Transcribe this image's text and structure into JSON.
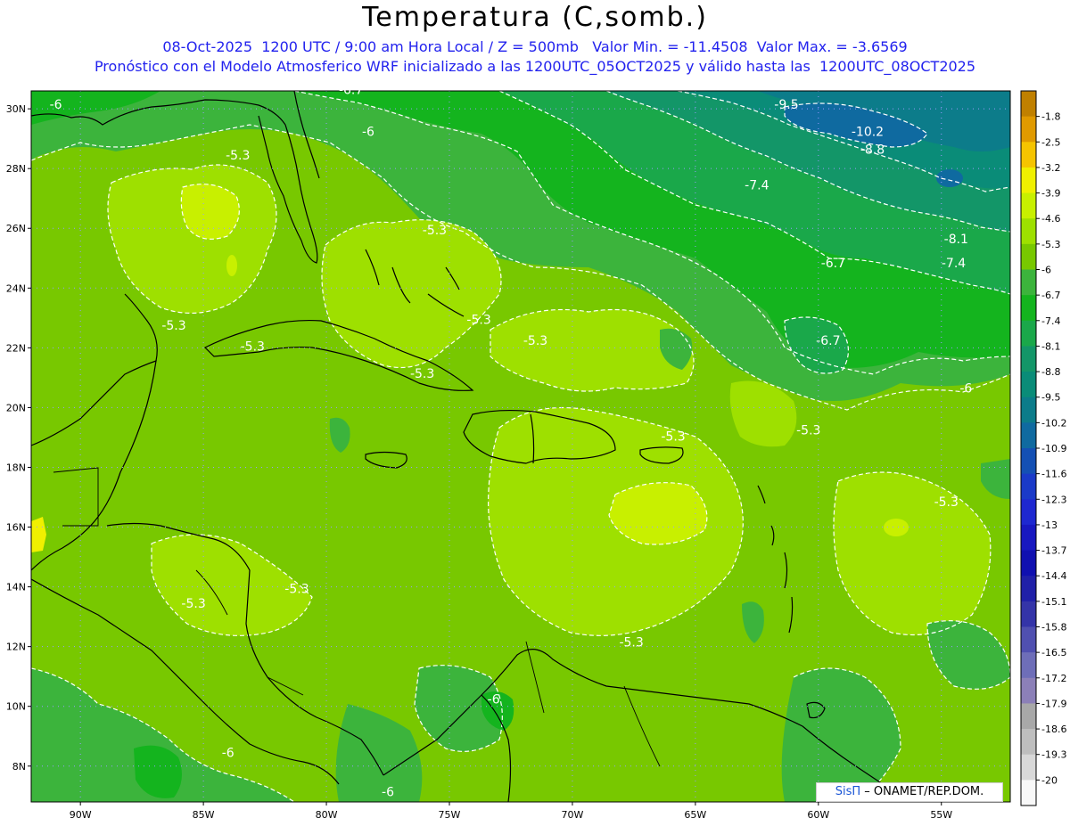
{
  "header": {
    "title": "Temperatura (C,somb.)",
    "subtitle_line1": "08-Oct-2025  1200 UTC / 9:00 am Hora Local / Z = 500mb   Valor Min. = -11.4508  Valor Max. = -3.6569",
    "subtitle_line2": "Pronóstico con el Modelo Atmosferico WRF inicializado a las 1200UTC_05OCT2025 y válido hasta las  1200UTC_08OCT2025"
  },
  "credit": {
    "brand": "SisΠ",
    "text": " – ONAMET/REP.DOM."
  },
  "map": {
    "lat_range": [
      6.8,
      30.6
    ],
    "lon_range": [
      -92,
      -52.2
    ],
    "lat_ticks": [
      "30N",
      "28N",
      "26N",
      "24N",
      "22N",
      "20N",
      "18N",
      "16N",
      "14N",
      "12N",
      "10N",
      "8N"
    ],
    "lon_ticks": [
      "90W",
      "85W",
      "80W",
      "75W",
      "70W",
      "65W",
      "60W",
      "55W"
    ],
    "contour_labels": [
      {
        "text": "-6",
        "lat": 30.0,
        "lon": -91.0
      },
      {
        "text": "-6.7",
        "lat": 30.5,
        "lon": -79.0
      },
      {
        "text": "-6",
        "lat": 29.1,
        "lon": -78.3
      },
      {
        "text": "-5.3",
        "lat": 28.3,
        "lon": -83.6
      },
      {
        "text": "-5.3",
        "lat": 25.8,
        "lon": -75.6
      },
      {
        "text": "-9.5",
        "lat": 30.0,
        "lon": -61.3
      },
      {
        "text": "-10.2",
        "lat": 29.1,
        "lon": -58.0
      },
      {
        "text": "-8.8",
        "lat": 28.5,
        "lon": -57.8
      },
      {
        "text": "-7.4",
        "lat": 27.3,
        "lon": -62.5
      },
      {
        "text": "-8.1",
        "lat": 25.5,
        "lon": -54.4
      },
      {
        "text": "-6.7",
        "lat": 24.7,
        "lon": -59.4
      },
      {
        "text": "-7.4",
        "lat": 24.7,
        "lon": -54.5
      },
      {
        "text": "-5.3",
        "lat": 22.8,
        "lon": -73.8
      },
      {
        "text": "-5.3",
        "lat": 22.1,
        "lon": -71.5
      },
      {
        "text": "-6.7",
        "lat": 22.1,
        "lon": -59.6
      },
      {
        "text": "-5.3",
        "lat": 22.6,
        "lon": -86.2
      },
      {
        "text": "-5.3",
        "lat": 21.9,
        "lon": -83.0
      },
      {
        "text": "-5.3",
        "lat": 21.0,
        "lon": -76.1
      },
      {
        "text": "-6",
        "lat": 20.5,
        "lon": -54.0
      },
      {
        "text": "-5.3",
        "lat": 18.9,
        "lon": -65.9
      },
      {
        "text": "-5.3",
        "lat": 19.1,
        "lon": -60.4
      },
      {
        "text": "-5.3",
        "lat": 16.7,
        "lon": -54.8
      },
      {
        "text": "-5.3",
        "lat": 13.8,
        "lon": -81.2
      },
      {
        "text": "-5.3",
        "lat": 13.3,
        "lon": -85.4
      },
      {
        "text": "-5.3",
        "lat": 12.0,
        "lon": -67.6
      },
      {
        "text": "-6",
        "lat": 10.1,
        "lon": -73.2
      },
      {
        "text": "-6",
        "lat": 8.3,
        "lon": -84.0
      },
      {
        "text": "-6",
        "lat": 7.0,
        "lon": -77.5
      }
    ]
  },
  "colorbar": {
    "labels": [
      "-1.8",
      "-2.5",
      "-3.2",
      "-3.9",
      "-4.6",
      "-5.3",
      "-6",
      "-6.7",
      "-7.4",
      "-8.1",
      "-8.8",
      "-9.5",
      "-10.2",
      "-10.9",
      "-11.6",
      "-12.3",
      "-13",
      "-13.7",
      "-14.4",
      "-15.1",
      "-15.8",
      "-16.5",
      "-17.2",
      "-17.9",
      "-18.6",
      "-19.3",
      "-20"
    ],
    "colors": [
      "#c08000",
      "#e09a00",
      "#f5c400",
      "#f0f000",
      "#c8f000",
      "#9ee000",
      "#78c800",
      "#3cb43c",
      "#14b41e",
      "#1aa84a",
      "#139668",
      "#0a8c78",
      "#0c7c8a",
      "#0f6aa0",
      "#1450b4",
      "#1a3ac8",
      "#1e28d0",
      "#1818c0",
      "#1010b0",
      "#2020a8",
      "#3434a8",
      "#5050b0",
      "#6e6eb8",
      "#8c80b8",
      "#a8a8a8",
      "#bebebe",
      "#d8d8d8",
      "#f8f8f8"
    ]
  }
}
